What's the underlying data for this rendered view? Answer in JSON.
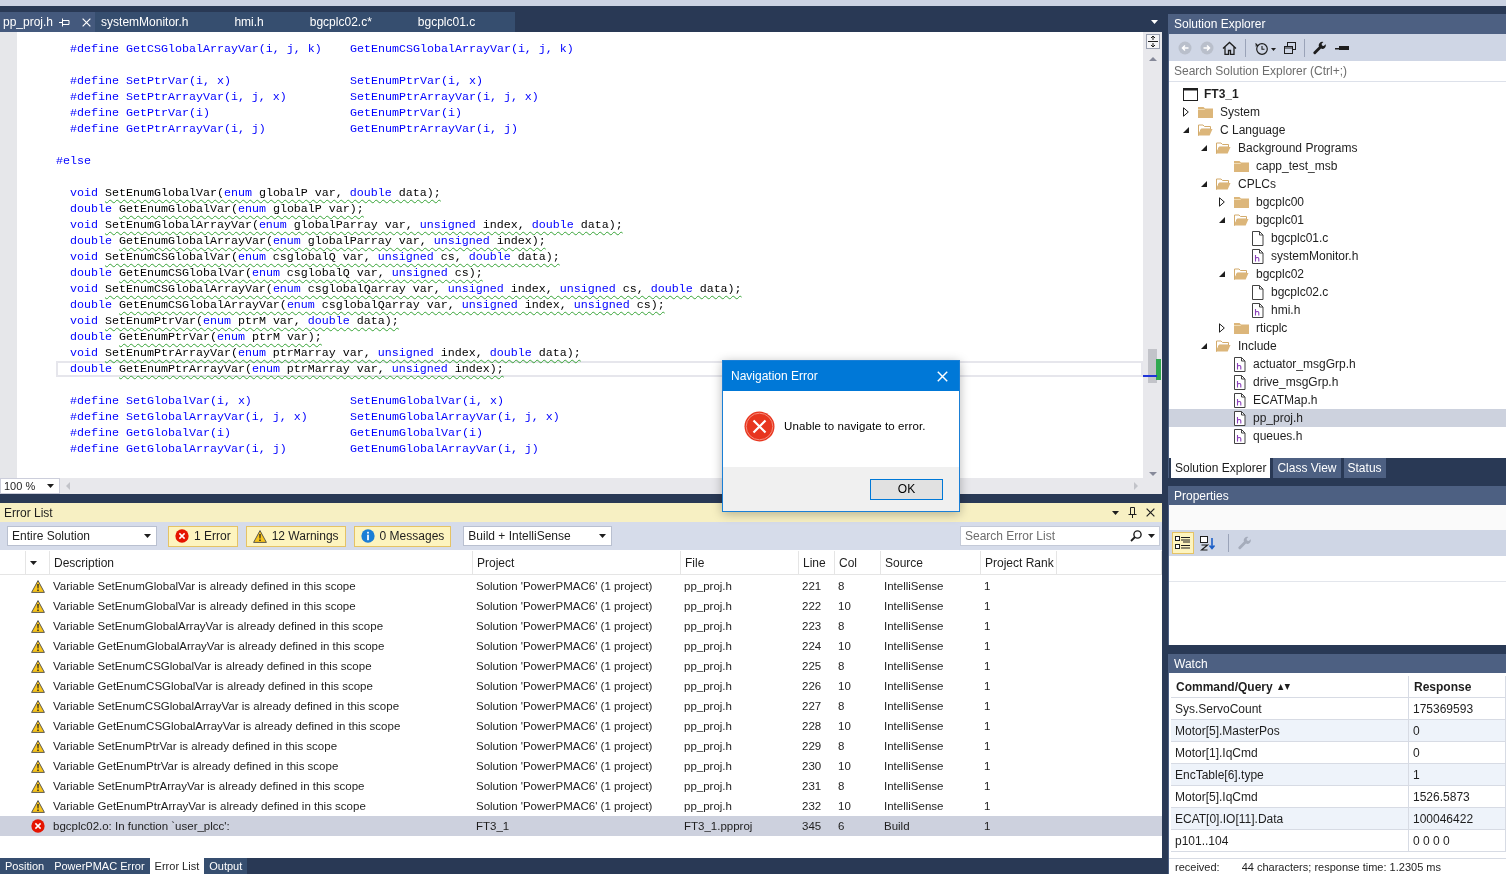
{
  "editor": {
    "tabs": [
      {
        "label": "pp_proj.h",
        "selected": true
      },
      {
        "label": "systemMonitor.h",
        "selected": false
      },
      {
        "label": "hmi.h",
        "selected": false
      },
      {
        "label": "bgcplc02.c*",
        "selected": false
      },
      {
        "label": "bgcplc01.c",
        "selected": false
      }
    ],
    "blocks": [
      {
        "lines": [
          {
            "kind": "define",
            "macro": "#define GetCSGlobalArrayVar(i, j, k)",
            "expansion": "GetEnumCSGlobalArrayVar(i, j, k)",
            "current": false
          }
        ]
      },
      {
        "lines": [
          {
            "kind": "define",
            "macro": "#define SetPtrVar(i, x)",
            "expansion": "SetEnumPtrVar(i, x)",
            "current": false
          },
          {
            "kind": "define",
            "macro": "#define SetPtrArrayVar(i, j, x)",
            "expansion": "SetEnumPtrArrayVar(i, j, x)",
            "current": false
          },
          {
            "kind": "define",
            "macro": "#define GetPtrVar(i)",
            "expansion": "GetEnumPtrVar(i)",
            "current": false
          },
          {
            "kind": "define",
            "macro": "#define GetPtrArrayVar(i, j)",
            "expansion": "GetEnumPtrArrayVar(i, j)",
            "current": false
          }
        ]
      },
      {
        "lines": [
          {
            "kind": "directive",
            "text": "#else",
            "current": false
          }
        ]
      },
      {
        "lines": [
          {
            "kind": "declaration",
            "return_type": "void",
            "squiggle": true,
            "current": false,
            "signature": [
              {
                "text": "SetEnumGlobalVar(",
                "keyword": false
              },
              {
                "text": "enum",
                "keyword": true
              },
              {
                "text": " globalP var, ",
                "keyword": false
              },
              {
                "text": "double",
                "keyword": true
              },
              {
                "text": " data);",
                "keyword": false
              }
            ]
          },
          {
            "kind": "declaration",
            "return_type": "double",
            "squiggle": true,
            "current": false,
            "signature": [
              {
                "text": "GetEnumGlobalVar(",
                "keyword": false
              },
              {
                "text": "enum",
                "keyword": true
              },
              {
                "text": " globalP var);",
                "keyword": false
              }
            ]
          },
          {
            "kind": "declaration",
            "return_type": "void",
            "squiggle": true,
            "current": false,
            "signature": [
              {
                "text": "SetEnumGlobalArrayVar(",
                "keyword": false
              },
              {
                "text": "enum",
                "keyword": true
              },
              {
                "text": " globalParray var, ",
                "keyword": false
              },
              {
                "text": "unsigned",
                "keyword": true
              },
              {
                "text": " index, ",
                "keyword": false
              },
              {
                "text": "double",
                "keyword": true
              },
              {
                "text": " data);",
                "keyword": false
              }
            ]
          },
          {
            "kind": "declaration",
            "return_type": "double",
            "squiggle": true,
            "current": false,
            "signature": [
              {
                "text": "GetEnumGlobalArrayVar(",
                "keyword": false
              },
              {
                "text": "enum",
                "keyword": true
              },
              {
                "text": " globalParray var, ",
                "keyword": false
              },
              {
                "text": "unsigned",
                "keyword": true
              },
              {
                "text": " index);",
                "keyword": false
              }
            ]
          },
          {
            "kind": "declaration",
            "return_type": "void",
            "squiggle": true,
            "current": false,
            "signature": [
              {
                "text": "SetEnumCSGlobalVar(",
                "keyword": false
              },
              {
                "text": "enum",
                "keyword": true
              },
              {
                "text": " csglobalQ var, ",
                "keyword": false
              },
              {
                "text": "unsigned",
                "keyword": true
              },
              {
                "text": " cs, ",
                "keyword": false
              },
              {
                "text": "double",
                "keyword": true
              },
              {
                "text": " data);",
                "keyword": false
              }
            ]
          },
          {
            "kind": "declaration",
            "return_type": "double",
            "squiggle": true,
            "current": false,
            "signature": [
              {
                "text": "GetEnumCSGlobalVar(",
                "keyword": false
              },
              {
                "text": "enum",
                "keyword": true
              },
              {
                "text": " csglobalQ var, ",
                "keyword": false
              },
              {
                "text": "unsigned",
                "keyword": true
              },
              {
                "text": " cs);",
                "keyword": false
              }
            ]
          },
          {
            "kind": "declaration",
            "return_type": "void",
            "squiggle": true,
            "current": false,
            "signature": [
              {
                "text": "SetEnumCSGlobalArrayVar(",
                "keyword": false
              },
              {
                "text": "enum",
                "keyword": true
              },
              {
                "text": " csglobalQarray var, ",
                "keyword": false
              },
              {
                "text": "unsigned",
                "keyword": true
              },
              {
                "text": " index, ",
                "keyword": false
              },
              {
                "text": "unsigned",
                "keyword": true
              },
              {
                "text": " cs, ",
                "keyword": false
              },
              {
                "text": "double",
                "keyword": true
              },
              {
                "text": " data);",
                "keyword": false
              }
            ]
          },
          {
            "kind": "declaration",
            "return_type": "double",
            "squiggle": true,
            "current": false,
            "signature": [
              {
                "text": "GetEnumCSGlobalArrayVar(",
                "keyword": false
              },
              {
                "text": "enum",
                "keyword": true
              },
              {
                "text": " csglobalQarray var, ",
                "keyword": false
              },
              {
                "text": "unsigned",
                "keyword": true
              },
              {
                "text": " index, ",
                "keyword": false
              },
              {
                "text": "unsigned",
                "keyword": true
              },
              {
                "text": " cs);",
                "keyword": false
              }
            ]
          },
          {
            "kind": "declaration",
            "return_type": "void",
            "squiggle": true,
            "current": false,
            "signature": [
              {
                "text": "SetEnumPtrVar(",
                "keyword": false
              },
              {
                "text": "enum",
                "keyword": true
              },
              {
                "text": " ptrM var, ",
                "keyword": false
              },
              {
                "text": "double",
                "keyword": true
              },
              {
                "text": " data);",
                "keyword": false
              }
            ]
          },
          {
            "kind": "declaration",
            "return_type": "double",
            "squiggle": true,
            "current": false,
            "signature": [
              {
                "text": "GetEnumPtrVar(",
                "keyword": false
              },
              {
                "text": "enum",
                "keyword": true
              },
              {
                "text": " ptrM var);",
                "keyword": false
              }
            ]
          },
          {
            "kind": "declaration",
            "return_type": "void",
            "squiggle": true,
            "current": false,
            "signature": [
              {
                "text": "SetEnumPtrArrayVar(",
                "keyword": false
              },
              {
                "text": "enum",
                "keyword": true
              },
              {
                "text": " ptrMarray var, ",
                "keyword": false
              },
              {
                "text": "unsigned",
                "keyword": true
              },
              {
                "text": " index, ",
                "keyword": false
              },
              {
                "text": "double",
                "keyword": true
              },
              {
                "text": " data);",
                "keyword": false
              }
            ]
          },
          {
            "kind": "declaration",
            "return_type": "double",
            "squiggle": true,
            "current": true,
            "signature": [
              {
                "text": "GetEnumPtrArrayVar(",
                "keyword": false
              },
              {
                "text": "enum",
                "keyword": true
              },
              {
                "text": " ptrMarray var, ",
                "keyword": false
              },
              {
                "text": "unsigned",
                "keyword": true
              },
              {
                "text": " index);",
                "keyword": false
              }
            ]
          }
        ]
      },
      {
        "lines": [
          {
            "kind": "define",
            "macro": "#define SetGlobalVar(i, x)",
            "expansion": "SetEnumGlobalVar(i, x)",
            "current": false
          },
          {
            "kind": "define",
            "macro": "#define SetGlobalArrayVar(i, j, x)",
            "expansion": "SetEnumGlobalArrayVar(i, j, x)",
            "current": false
          },
          {
            "kind": "define",
            "macro": "#define GetGlobalVar(i)",
            "expansion": "GetEnumGlobalVar(i)",
            "current": false
          },
          {
            "kind": "define",
            "macro": "#define GetGlobalArrayVar(i, j)",
            "expansion": "GetEnumGlobalArrayVar(i, j)",
            "current": false
          }
        ]
      }
    ],
    "zoom": "100 %"
  },
  "dialog": {
    "title": "Navigation Error",
    "message": "Unable to navigate to error.",
    "button": "OK"
  },
  "error_list": {
    "title": "Error List",
    "scope": "Entire Solution",
    "filters": [
      {
        "kind": "error",
        "label": "1 Error",
        "selected": true
      },
      {
        "kind": "warning",
        "label": "12 Warnings",
        "selected": true
      },
      {
        "kind": "message",
        "label": "0 Messages",
        "selected": true
      }
    ],
    "build_filter": "Build + IntelliSense",
    "search": {
      "placeholder": "Search Error List"
    },
    "columns": [
      "Description",
      "Project",
      "File",
      "Line",
      "Col",
      "Source",
      "Project Rank"
    ],
    "rows": [
      {
        "kind": "warning",
        "description": "Variable SetEnumGlobalVar is already defined in this scope",
        "project": "Solution 'PowerPMAC6' (1 project)",
        "file": "pp_proj.h",
        "line": "221",
        "col": "8",
        "source": "IntelliSense",
        "project_rank": "1",
        "selected": false
      },
      {
        "kind": "warning",
        "description": "Variable SetEnumGlobalVar is already defined in this scope",
        "project": "Solution 'PowerPMAC6' (1 project)",
        "file": "pp_proj.h",
        "line": "222",
        "col": "10",
        "source": "IntelliSense",
        "project_rank": "1",
        "selected": false
      },
      {
        "kind": "warning",
        "description": "Variable SetEnumGlobalArrayVar is already defined in this scope",
        "project": "Solution 'PowerPMAC6' (1 project)",
        "file": "pp_proj.h",
        "line": "223",
        "col": "8",
        "source": "IntelliSense",
        "project_rank": "1",
        "selected": false
      },
      {
        "kind": "warning",
        "description": "Variable GetEnumGlobalArrayVar is already defined in this scope",
        "project": "Solution 'PowerPMAC6' (1 project)",
        "file": "pp_proj.h",
        "line": "224",
        "col": "10",
        "source": "IntelliSense",
        "project_rank": "1",
        "selected": false
      },
      {
        "kind": "warning",
        "description": "Variable SetEnumCSGlobalVar is already defined in this scope",
        "project": "Solution 'PowerPMAC6' (1 project)",
        "file": "pp_proj.h",
        "line": "225",
        "col": "8",
        "source": "IntelliSense",
        "project_rank": "1",
        "selected": false
      },
      {
        "kind": "warning",
        "description": "Variable GetEnumCSGlobalVar is already defined in this scope",
        "project": "Solution 'PowerPMAC6' (1 project)",
        "file": "pp_proj.h",
        "line": "226",
        "col": "10",
        "source": "IntelliSense",
        "project_rank": "1",
        "selected": false
      },
      {
        "kind": "warning",
        "description": "Variable SetEnumCSGlobalArrayVar is already defined in this scope",
        "project": "Solution 'PowerPMAC6' (1 project)",
        "file": "pp_proj.h",
        "line": "227",
        "col": "8",
        "source": "IntelliSense",
        "project_rank": "1",
        "selected": false
      },
      {
        "kind": "warning",
        "description": "Variable GetEnumCSGlobalArrayVar is already defined in this scope",
        "project": "Solution 'PowerPMAC6' (1 project)",
        "file": "pp_proj.h",
        "line": "228",
        "col": "10",
        "source": "IntelliSense",
        "project_rank": "1",
        "selected": false
      },
      {
        "kind": "warning",
        "description": "Variable SetEnumPtrVar is already defined in this scope",
        "project": "Solution 'PowerPMAC6' (1 project)",
        "file": "pp_proj.h",
        "line": "229",
        "col": "8",
        "source": "IntelliSense",
        "project_rank": "1",
        "selected": false
      },
      {
        "kind": "warning",
        "description": "Variable GetEnumPtrVar is already defined in this scope",
        "project": "Solution 'PowerPMAC6' (1 project)",
        "file": "pp_proj.h",
        "line": "230",
        "col": "10",
        "source": "IntelliSense",
        "project_rank": "1",
        "selected": false
      },
      {
        "kind": "warning",
        "description": "Variable SetEnumPtrArrayVar is already defined in this scope",
        "project": "Solution 'PowerPMAC6' (1 project)",
        "file": "pp_proj.h",
        "line": "231",
        "col": "8",
        "source": "IntelliSense",
        "project_rank": "1",
        "selected": false
      },
      {
        "kind": "warning",
        "description": "Variable GetEnumPtrArrayVar is already defined in this scope",
        "project": "Solution 'PowerPMAC6' (1 project)",
        "file": "pp_proj.h",
        "line": "232",
        "col": "10",
        "source": "IntelliSense",
        "project_rank": "1",
        "selected": false
      },
      {
        "kind": "error",
        "description": "bgcplc02.o: In function `user_plcc':",
        "project": "FT3_1",
        "file": "FT3_1.ppproj",
        "line": "345",
        "col": "6",
        "source": "Build",
        "project_rank": "1",
        "selected": true
      }
    ]
  },
  "output_tabs": [
    {
      "label": "Position",
      "selected": false
    },
    {
      "label": "PowerPMAC Error",
      "selected": false
    },
    {
      "label": "Error List",
      "selected": true
    },
    {
      "label": "Output",
      "selected": false
    }
  ],
  "solution_explorer": {
    "title": "Solution Explorer",
    "toolbar": [
      {
        "kind": "back",
        "disabled": true
      },
      {
        "kind": "forward",
        "disabled": true
      },
      {
        "kind": "home",
        "disabled": false
      },
      {
        "kind": "separator"
      },
      {
        "kind": "history",
        "disabled": false
      },
      {
        "kind": "windows",
        "disabled": false
      },
      {
        "kind": "separator"
      },
      {
        "kind": "wrench",
        "disabled": false
      },
      {
        "kind": "collapse",
        "disabled": false
      }
    ],
    "search": {
      "placeholder": "Search Solution Explorer (Ctrl+;)"
    },
    "tree": [
      {
        "kind": "solution",
        "label": "FT3_1",
        "selected": false,
        "children": [
          {
            "kind": "folder",
            "label": "System",
            "expanded": false,
            "selected": false
          },
          {
            "kind": "folder",
            "label": "C Language",
            "expanded": true,
            "selected": false,
            "children": [
              {
                "kind": "folder",
                "label": "Background Programs",
                "expanded": true,
                "selected": false,
                "children": [
                  {
                    "kind": "folder",
                    "label": "capp_test_msb",
                    "selected": false
                  }
                ]
              },
              {
                "kind": "folder",
                "label": "CPLCs",
                "expanded": true,
                "selected": false,
                "children": [
                  {
                    "kind": "folder",
                    "label": "bgcplc00",
                    "expanded": false,
                    "selected": false
                  },
                  {
                    "kind": "folder",
                    "label": "bgcplc01",
                    "expanded": true,
                    "selected": false,
                    "children": [
                      {
                        "kind": "source",
                        "label": "bgcplc01.c",
                        "selected": false
                      },
                      {
                        "kind": "header",
                        "label": "systemMonitor.h",
                        "selected": false
                      }
                    ]
                  },
                  {
                    "kind": "folder",
                    "label": "bgcplc02",
                    "expanded": true,
                    "selected": false,
                    "children": [
                      {
                        "kind": "source",
                        "label": "bgcplc02.c",
                        "selected": false
                      },
                      {
                        "kind": "header",
                        "label": "hmi.h",
                        "selected": false
                      }
                    ]
                  },
                  {
                    "kind": "folder",
                    "label": "rticplc",
                    "expanded": false,
                    "selected": false
                  }
                ]
              },
              {
                "kind": "folder",
                "label": "Include",
                "expanded": true,
                "selected": false,
                "children": [
                  {
                    "kind": "header",
                    "label": "actuator_msgGrp.h",
                    "selected": false
                  },
                  {
                    "kind": "header",
                    "label": "drive_msgGrp.h",
                    "selected": false
                  },
                  {
                    "kind": "header",
                    "label": "ECATMap.h",
                    "selected": false
                  },
                  {
                    "kind": "header",
                    "label": "pp_proj.h",
                    "selected": true
                  },
                  {
                    "kind": "header",
                    "label": "queues.h",
                    "selected": false
                  }
                ]
              }
            ]
          }
        ]
      }
    ],
    "tabs": [
      {
        "label": "Solution Explorer",
        "selected": true
      },
      {
        "label": "Class View",
        "selected": false
      },
      {
        "label": "Status",
        "selected": false
      }
    ]
  },
  "properties": {
    "title": "Properties",
    "toolbar": [
      {
        "kind": "categorized",
        "selected": true
      },
      {
        "kind": "alphabetical",
        "selected": false
      },
      {
        "kind": "separator"
      },
      {
        "kind": "wrench",
        "disabled": true
      }
    ]
  },
  "watch": {
    "title": "Watch",
    "columns": [
      "Command/Query",
      "Response"
    ],
    "rows": [
      {
        "query": "Sys.ServoCount",
        "response": "175369593"
      },
      {
        "query": "Motor[5].MasterPos",
        "response": "0"
      },
      {
        "query": "Motor[1].IqCmd",
        "response": "0"
      },
      {
        "query": "EncTable[6].type",
        "response": "1"
      },
      {
        "query": "Motor[5].IqCmd",
        "response": "1526.5873"
      },
      {
        "query": "ECAT[0].IO[11].Data",
        "response": "100046422"
      },
      {
        "query": "p101..104",
        "response": "0 0 0 0"
      }
    ],
    "status": {
      "label": "received:",
      "detail": "44 characters; response time: 1.2305 ms"
    }
  }
}
